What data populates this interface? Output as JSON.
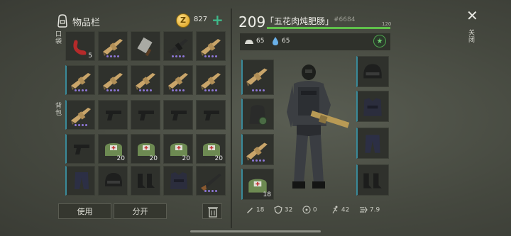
{
  "inventory": {
    "title": "物品栏",
    "coins": "827",
    "coin_symbol": "Z",
    "pocket_label": "口袋",
    "backpack_label": "背包"
  },
  "grid": [
    {
      "icon": "red-pepper-icon",
      "count": "5",
      "dots": 0
    },
    {
      "icon": "rifle-icon",
      "count": "",
      "dots": 4
    },
    {
      "icon": "cleaver-icon",
      "count": "",
      "dots": 0
    },
    {
      "icon": "black-rifle-icon",
      "count": "",
      "dots": 4
    },
    {
      "icon": "rifle-icon",
      "count": "",
      "dots": 4
    },
    {
      "icon": "rifle-icon",
      "count": "",
      "dots": 4
    },
    {
      "icon": "rifle-icon",
      "count": "",
      "dots": 4
    },
    {
      "icon": "rifle-icon",
      "count": "",
      "dots": 4
    },
    {
      "icon": "rifle-icon",
      "count": "",
      "dots": 4
    },
    {
      "icon": "rifle-icon",
      "count": "",
      "dots": 4
    },
    {
      "icon": "rifle-icon",
      "count": "",
      "dots": 4
    },
    {
      "icon": "pistol-icon",
      "count": "",
      "dots": 0
    },
    {
      "icon": "pistol-icon",
      "count": "",
      "dots": 0
    },
    {
      "icon": "pistol-icon",
      "count": "",
      "dots": 0
    },
    {
      "icon": "pistol-icon",
      "count": "",
      "dots": 0
    },
    {
      "icon": "pistol-icon",
      "count": "",
      "dots": 0
    },
    {
      "icon": "medkit-icon",
      "count": "20",
      "dots": 0
    },
    {
      "icon": "medkit-icon",
      "count": "20",
      "dots": 0
    },
    {
      "icon": "medkit-icon",
      "count": "20",
      "dots": 0
    },
    {
      "icon": "medkit-icon",
      "count": "20",
      "dots": 0
    },
    {
      "icon": "pants-icon",
      "count": "",
      "dots": 0
    },
    {
      "icon": "helmet-icon",
      "count": "",
      "dots": 0
    },
    {
      "icon": "boots-icon",
      "count": "",
      "dots": 0
    },
    {
      "icon": "vest-icon",
      "count": "",
      "dots": 0
    },
    {
      "icon": "shotgun-icon",
      "count": "",
      "dots": 4
    }
  ],
  "buttons": {
    "use": "使用",
    "split": "分开"
  },
  "player": {
    "level": "209",
    "name": "「五花肉炖肥肠」",
    "id": "#6684",
    "xp_max": "120",
    "food": "65",
    "water": "65",
    "star": "★"
  },
  "equip_left": [
    {
      "icon": "rifle-icon",
      "dots": 4,
      "count": ""
    },
    {
      "icon": "backpack-icon",
      "dots": 0,
      "count": ""
    },
    {
      "icon": "rifle-icon",
      "dots": 4,
      "count": ""
    },
    {
      "icon": "medkit-icon",
      "dots": 0,
      "count": "18"
    }
  ],
  "equip_right": [
    {
      "icon": "helmet-icon"
    },
    {
      "icon": "vest-icon"
    },
    {
      "icon": "pants-icon"
    },
    {
      "icon": "boots-icon"
    }
  ],
  "stats": {
    "attack": "18",
    "defense": "32",
    "radiation": "0",
    "speed": "42",
    "agility": "7.9"
  },
  "close": {
    "symbol": "✕",
    "label": "关闭"
  }
}
